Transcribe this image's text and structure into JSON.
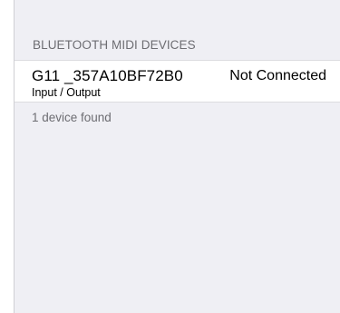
{
  "section": {
    "header": "BLUETOOTH MIDI DEVICES"
  },
  "devices": [
    {
      "name": "G11 _357A10BF72B0",
      "type": "Input / Output",
      "status": "Not Connected"
    }
  ],
  "footer": {
    "count_text": "1 device found"
  },
  "colors": {
    "background": "#efeff4",
    "secondary_text": "#6d6d72",
    "row_background": "#ffffff"
  }
}
